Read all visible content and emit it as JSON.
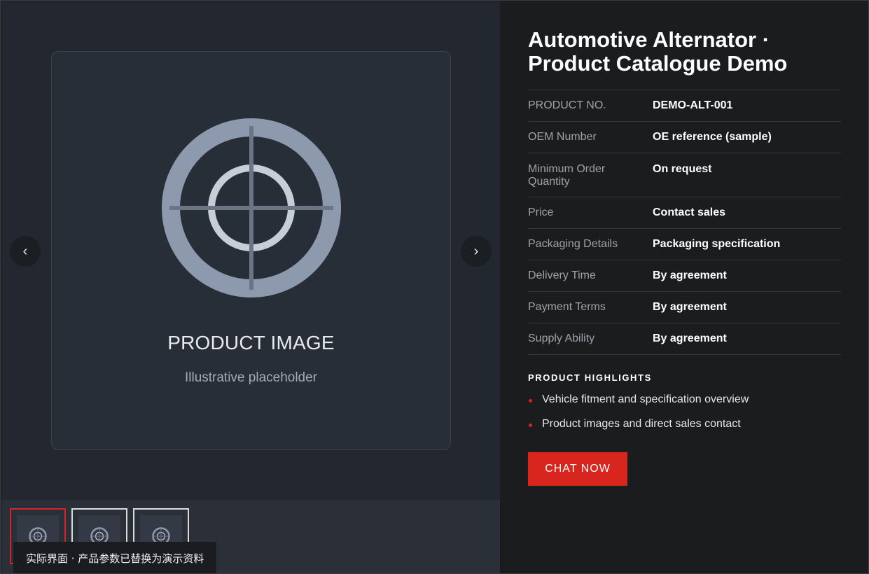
{
  "gallery": {
    "main_image": {
      "label": "PRODUCT IMAGE",
      "sublabel": "Illustrative placeholder",
      "icon": "crosshair-placeholder-icon"
    },
    "prev_label": "‹",
    "next_label": "›",
    "thumbnails": [
      {
        "icon": "crosshair-placeholder-icon",
        "active": true
      },
      {
        "icon": "crosshair-placeholder-icon",
        "active": false
      },
      {
        "icon": "crosshair-placeholder-icon",
        "active": false
      }
    ],
    "notice": "实际界面 · 产品参数已替换为演示资料"
  },
  "product": {
    "title": "Automotive Alternator · Product Catalogue Demo",
    "specs": [
      {
        "key": "PRODUCT NO.",
        "value": "DEMO-ALT-001"
      },
      {
        "key": "OEM Number",
        "value": "OE reference (sample)"
      },
      {
        "key": "Minimum Order Quantity",
        "value": "On request"
      },
      {
        "key": "Price",
        "value": "Contact sales"
      },
      {
        "key": "Packaging Details",
        "value": "Packaging specification"
      },
      {
        "key": "Delivery Time",
        "value": "By agreement"
      },
      {
        "key": "Payment Terms",
        "value": "By agreement"
      },
      {
        "key": "Supply Ability",
        "value": "By agreement"
      }
    ],
    "highlights_title": "PRODUCT HIGHLIGHTS",
    "highlights": [
      "Vehicle fitment and specification overview",
      "Product images and direct sales contact"
    ],
    "cta_label": "CHAT NOW"
  },
  "colors": {
    "accent": "#d8261f",
    "page_bg": "#1b1c1e",
    "gallery_bg": "#222730",
    "card_bg": "#282e38"
  }
}
